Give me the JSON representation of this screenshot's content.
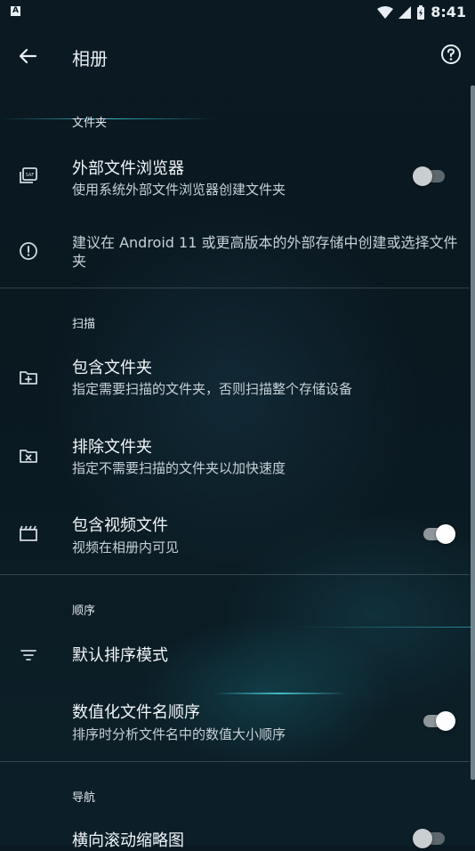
{
  "status_bar": {
    "time": "8:41",
    "left_badge": "A"
  },
  "app_bar": {
    "title": "相册"
  },
  "sections": {
    "folders": {
      "header": "文件夹",
      "external_browser": {
        "title": "外部文件浏览器",
        "subtitle": "使用系统外部文件浏览器创建文件夹",
        "enabled": false
      },
      "notice": {
        "text": "建议在 Android 11 或更高版本的外部存储中创建或选择文件夹"
      }
    },
    "scan": {
      "header": "扫描",
      "include_folders": {
        "title": "包含文件夹",
        "subtitle": "指定需要扫描的文件夹，否则扫描整个存储设备"
      },
      "exclude_folders": {
        "title": "排除文件夹",
        "subtitle": "指定不需要扫描的文件夹以加快速度"
      },
      "include_videos": {
        "title": "包含视频文件",
        "subtitle": "视频在相册内可见",
        "enabled": true
      }
    },
    "order": {
      "header": "顺序",
      "default_sort": {
        "title": "默认排序模式"
      },
      "numeric_sort": {
        "title": "数值化文件名顺序",
        "subtitle": "排序时分析文件名中的数值大小顺序",
        "enabled": true
      }
    },
    "navigation": {
      "header": "导航",
      "horizontal_scroll": {
        "title": "横向滚动缩略图",
        "enabled": false
      }
    }
  },
  "icons": {
    "back": "arrow-back-icon",
    "help": "help-circle-icon",
    "external_browser": "saf-folders-icon",
    "notice": "info-circle-icon",
    "include": "folder-plus-icon",
    "exclude": "folder-x-icon",
    "video": "film-icon",
    "sort": "sort-lines-icon"
  },
  "colors": {
    "background": "#0b1a22",
    "switch_on_thumb": "#ffffff",
    "switch_off_thumb": "#c9ced1"
  }
}
